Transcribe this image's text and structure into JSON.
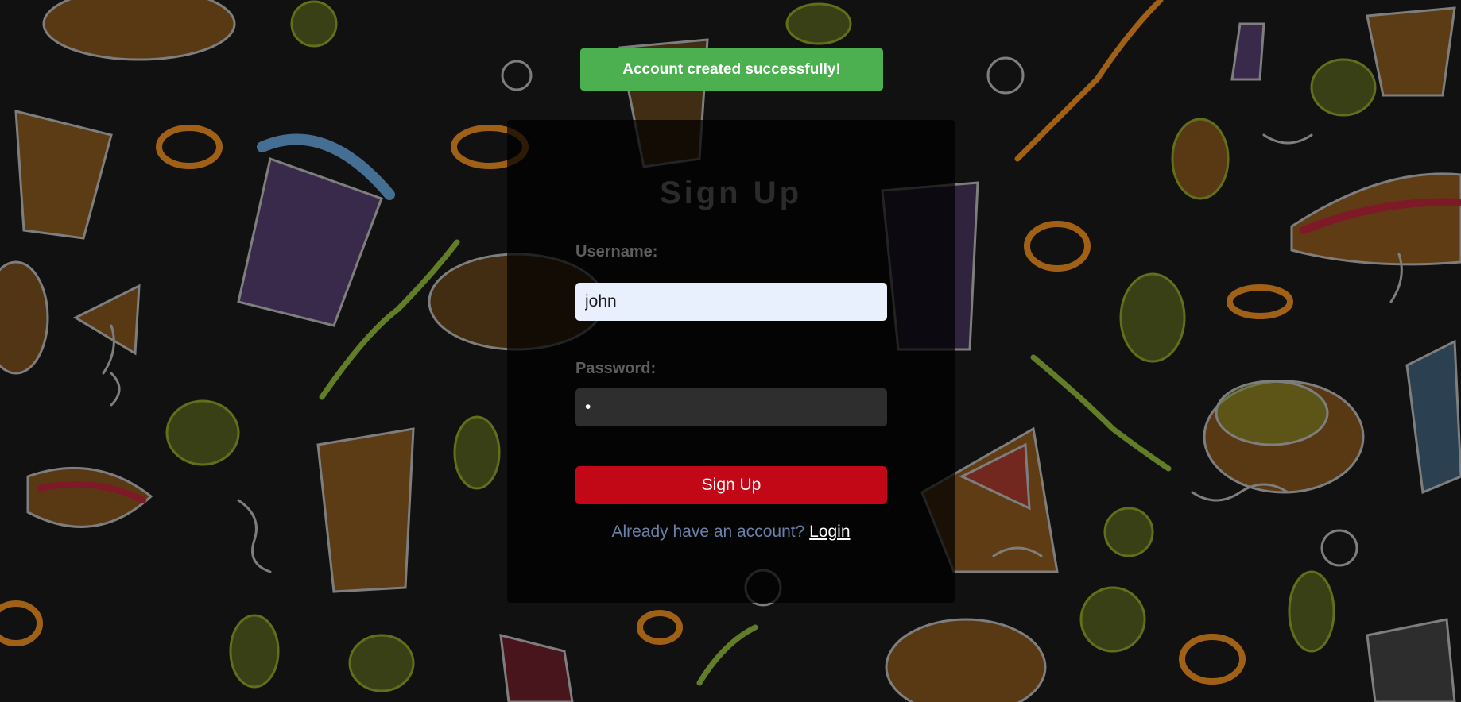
{
  "toast": {
    "message": "Account created successfully!",
    "color": "#4caf50"
  },
  "form": {
    "title": "Sign Up",
    "username_label": "Username:",
    "username_value": "john",
    "password_label": "Password:",
    "password_value": "•",
    "submit_label": "Sign Up",
    "login_prompt": "Already have an account?",
    "login_link": "Login"
  },
  "colors": {
    "background": "#121111",
    "submit_button": "#c20716",
    "username_field": "#e8f0fe",
    "password_field": "#2e2e2e",
    "login_prompt": "#6b82a8"
  },
  "background_icons": [
    "burger-icon",
    "hotdog-icon",
    "drink-cup-icon",
    "pizza-slice-icon",
    "onion-ring-icon",
    "lettuce-icon",
    "squiggle-icon"
  ]
}
